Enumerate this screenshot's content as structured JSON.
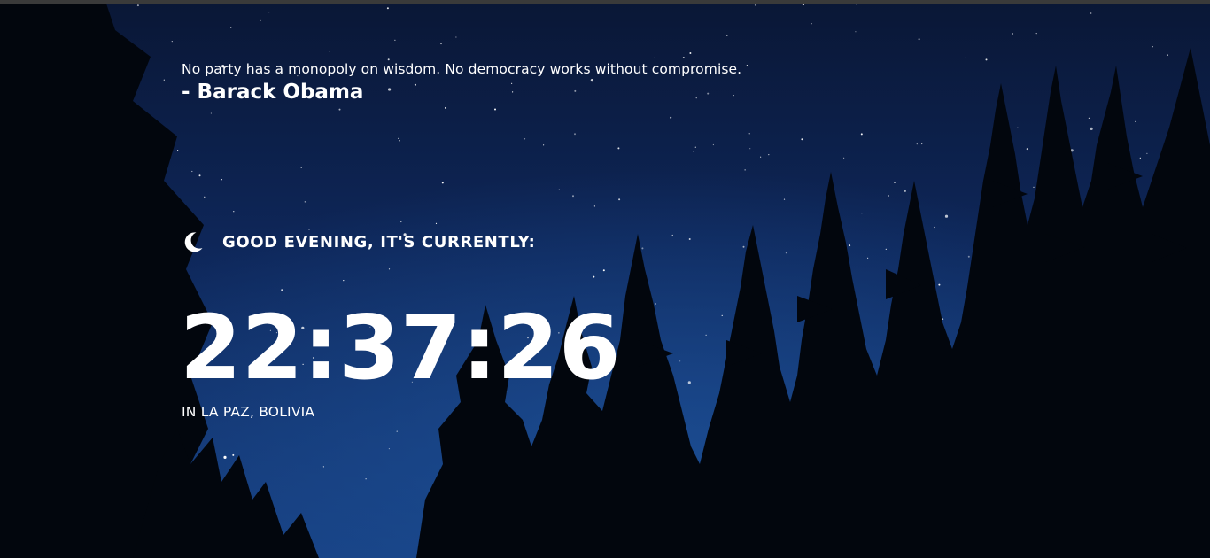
{
  "quote": {
    "text": "No party has a monopoly on wisdom. No democracy works without compromise.",
    "author": "- Barack Obama"
  },
  "greeting": {
    "icon": "moon-icon",
    "text": "GOOD EVENING, IT'S CURRENTLY:"
  },
  "clock": {
    "time": "22:37:26"
  },
  "location": {
    "text": "IN LA PAZ, BOLIVIA"
  },
  "colors": {
    "sky_top": "#0a1836",
    "sky_mid": "#0f2a5c",
    "sky_glow": "#1a4a8e",
    "trees": "#02060d",
    "text": "#ffffff"
  }
}
